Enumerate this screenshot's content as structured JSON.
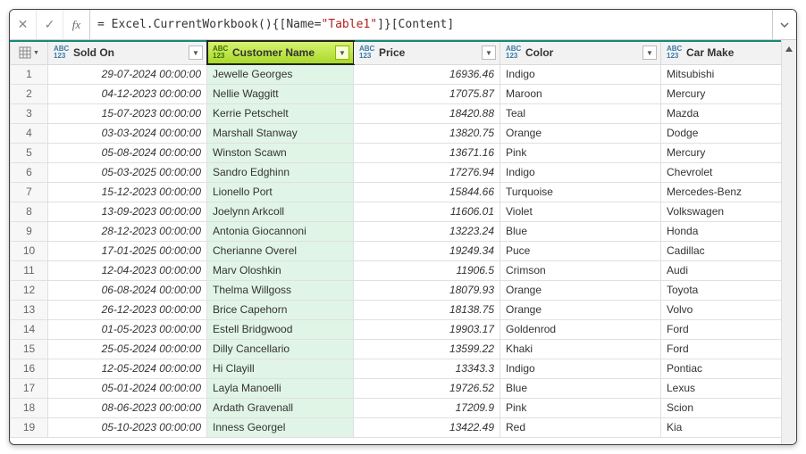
{
  "formula": {
    "prefix": "= Excel.CurrentWorkbook(){[Name=",
    "string": "\"Table1\"",
    "suffix": "]}[Content]"
  },
  "columns": {
    "soldOn": "Sold On",
    "customer": "Customer Name",
    "price": "Price",
    "color": "Color",
    "carMake": "Car Make"
  },
  "dtype": {
    "abc": "ABC",
    "n123": "123"
  },
  "rows": [
    {
      "n": "1",
      "soldOn": "29-07-2024 00:00:00",
      "customer": "Jewelle Georges",
      "price": "16936.46",
      "color": "Indigo",
      "make": "Mitsubishi"
    },
    {
      "n": "2",
      "soldOn": "04-12-2023 00:00:00",
      "customer": "Nellie Waggitt",
      "price": "17075.87",
      "color": "Maroon",
      "make": "Mercury"
    },
    {
      "n": "3",
      "soldOn": "15-07-2023 00:00:00",
      "customer": "Kerrie Petschelt",
      "price": "18420.88",
      "color": "Teal",
      "make": "Mazda"
    },
    {
      "n": "4",
      "soldOn": "03-03-2024 00:00:00",
      "customer": "Marshall Stanway",
      "price": "13820.75",
      "color": "Orange",
      "make": "Dodge"
    },
    {
      "n": "5",
      "soldOn": "05-08-2024 00:00:00",
      "customer": "Winston Scawn",
      "price": "13671.16",
      "color": "Pink",
      "make": "Mercury"
    },
    {
      "n": "6",
      "soldOn": "05-03-2025 00:00:00",
      "customer": "Sandro Edghinn",
      "price": "17276.94",
      "color": "Indigo",
      "make": "Chevrolet"
    },
    {
      "n": "7",
      "soldOn": "15-12-2023 00:00:00",
      "customer": "Lionello Port",
      "price": "15844.66",
      "color": "Turquoise",
      "make": "Mercedes-Benz"
    },
    {
      "n": "8",
      "soldOn": "13-09-2023 00:00:00",
      "customer": "Joelynn Arkcoll",
      "price": "11606.01",
      "color": "Violet",
      "make": "Volkswagen"
    },
    {
      "n": "9",
      "soldOn": "28-12-2023 00:00:00",
      "customer": "Antonia Giocannoni",
      "price": "13223.24",
      "color": "Blue",
      "make": "Honda"
    },
    {
      "n": "10",
      "soldOn": "17-01-2025 00:00:00",
      "customer": "Cherianne Overel",
      "price": "19249.34",
      "color": "Puce",
      "make": "Cadillac"
    },
    {
      "n": "11",
      "soldOn": "12-04-2023 00:00:00",
      "customer": "Marv Oloshkin",
      "price": "11906.5",
      "color": "Crimson",
      "make": "Audi"
    },
    {
      "n": "12",
      "soldOn": "06-08-2024 00:00:00",
      "customer": "Thelma Willgoss",
      "price": "18079.93",
      "color": "Orange",
      "make": "Toyota"
    },
    {
      "n": "13",
      "soldOn": "26-12-2023 00:00:00",
      "customer": "Brice Capehorn",
      "price": "18138.75",
      "color": "Orange",
      "make": "Volvo"
    },
    {
      "n": "14",
      "soldOn": "01-05-2023 00:00:00",
      "customer": "Estell Bridgwood",
      "price": "19903.17",
      "color": "Goldenrod",
      "make": "Ford"
    },
    {
      "n": "15",
      "soldOn": "25-05-2024 00:00:00",
      "customer": "Dilly Cancellario",
      "price": "13599.22",
      "color": "Khaki",
      "make": "Ford"
    },
    {
      "n": "16",
      "soldOn": "12-05-2024 00:00:00",
      "customer": "Hi Clayill",
      "price": "13343.3",
      "color": "Indigo",
      "make": "Pontiac"
    },
    {
      "n": "17",
      "soldOn": "05-01-2024 00:00:00",
      "customer": "Layla Manoelli",
      "price": "19726.52",
      "color": "Blue",
      "make": "Lexus"
    },
    {
      "n": "18",
      "soldOn": "08-06-2023 00:00:00",
      "customer": "Ardath Gravenall",
      "price": "17209.9",
      "color": "Pink",
      "make": "Scion"
    },
    {
      "n": "19",
      "soldOn": "05-10-2023 00:00:00",
      "customer": "Inness Georgel",
      "price": "13422.49",
      "color": "Red",
      "make": "Kia"
    }
  ]
}
